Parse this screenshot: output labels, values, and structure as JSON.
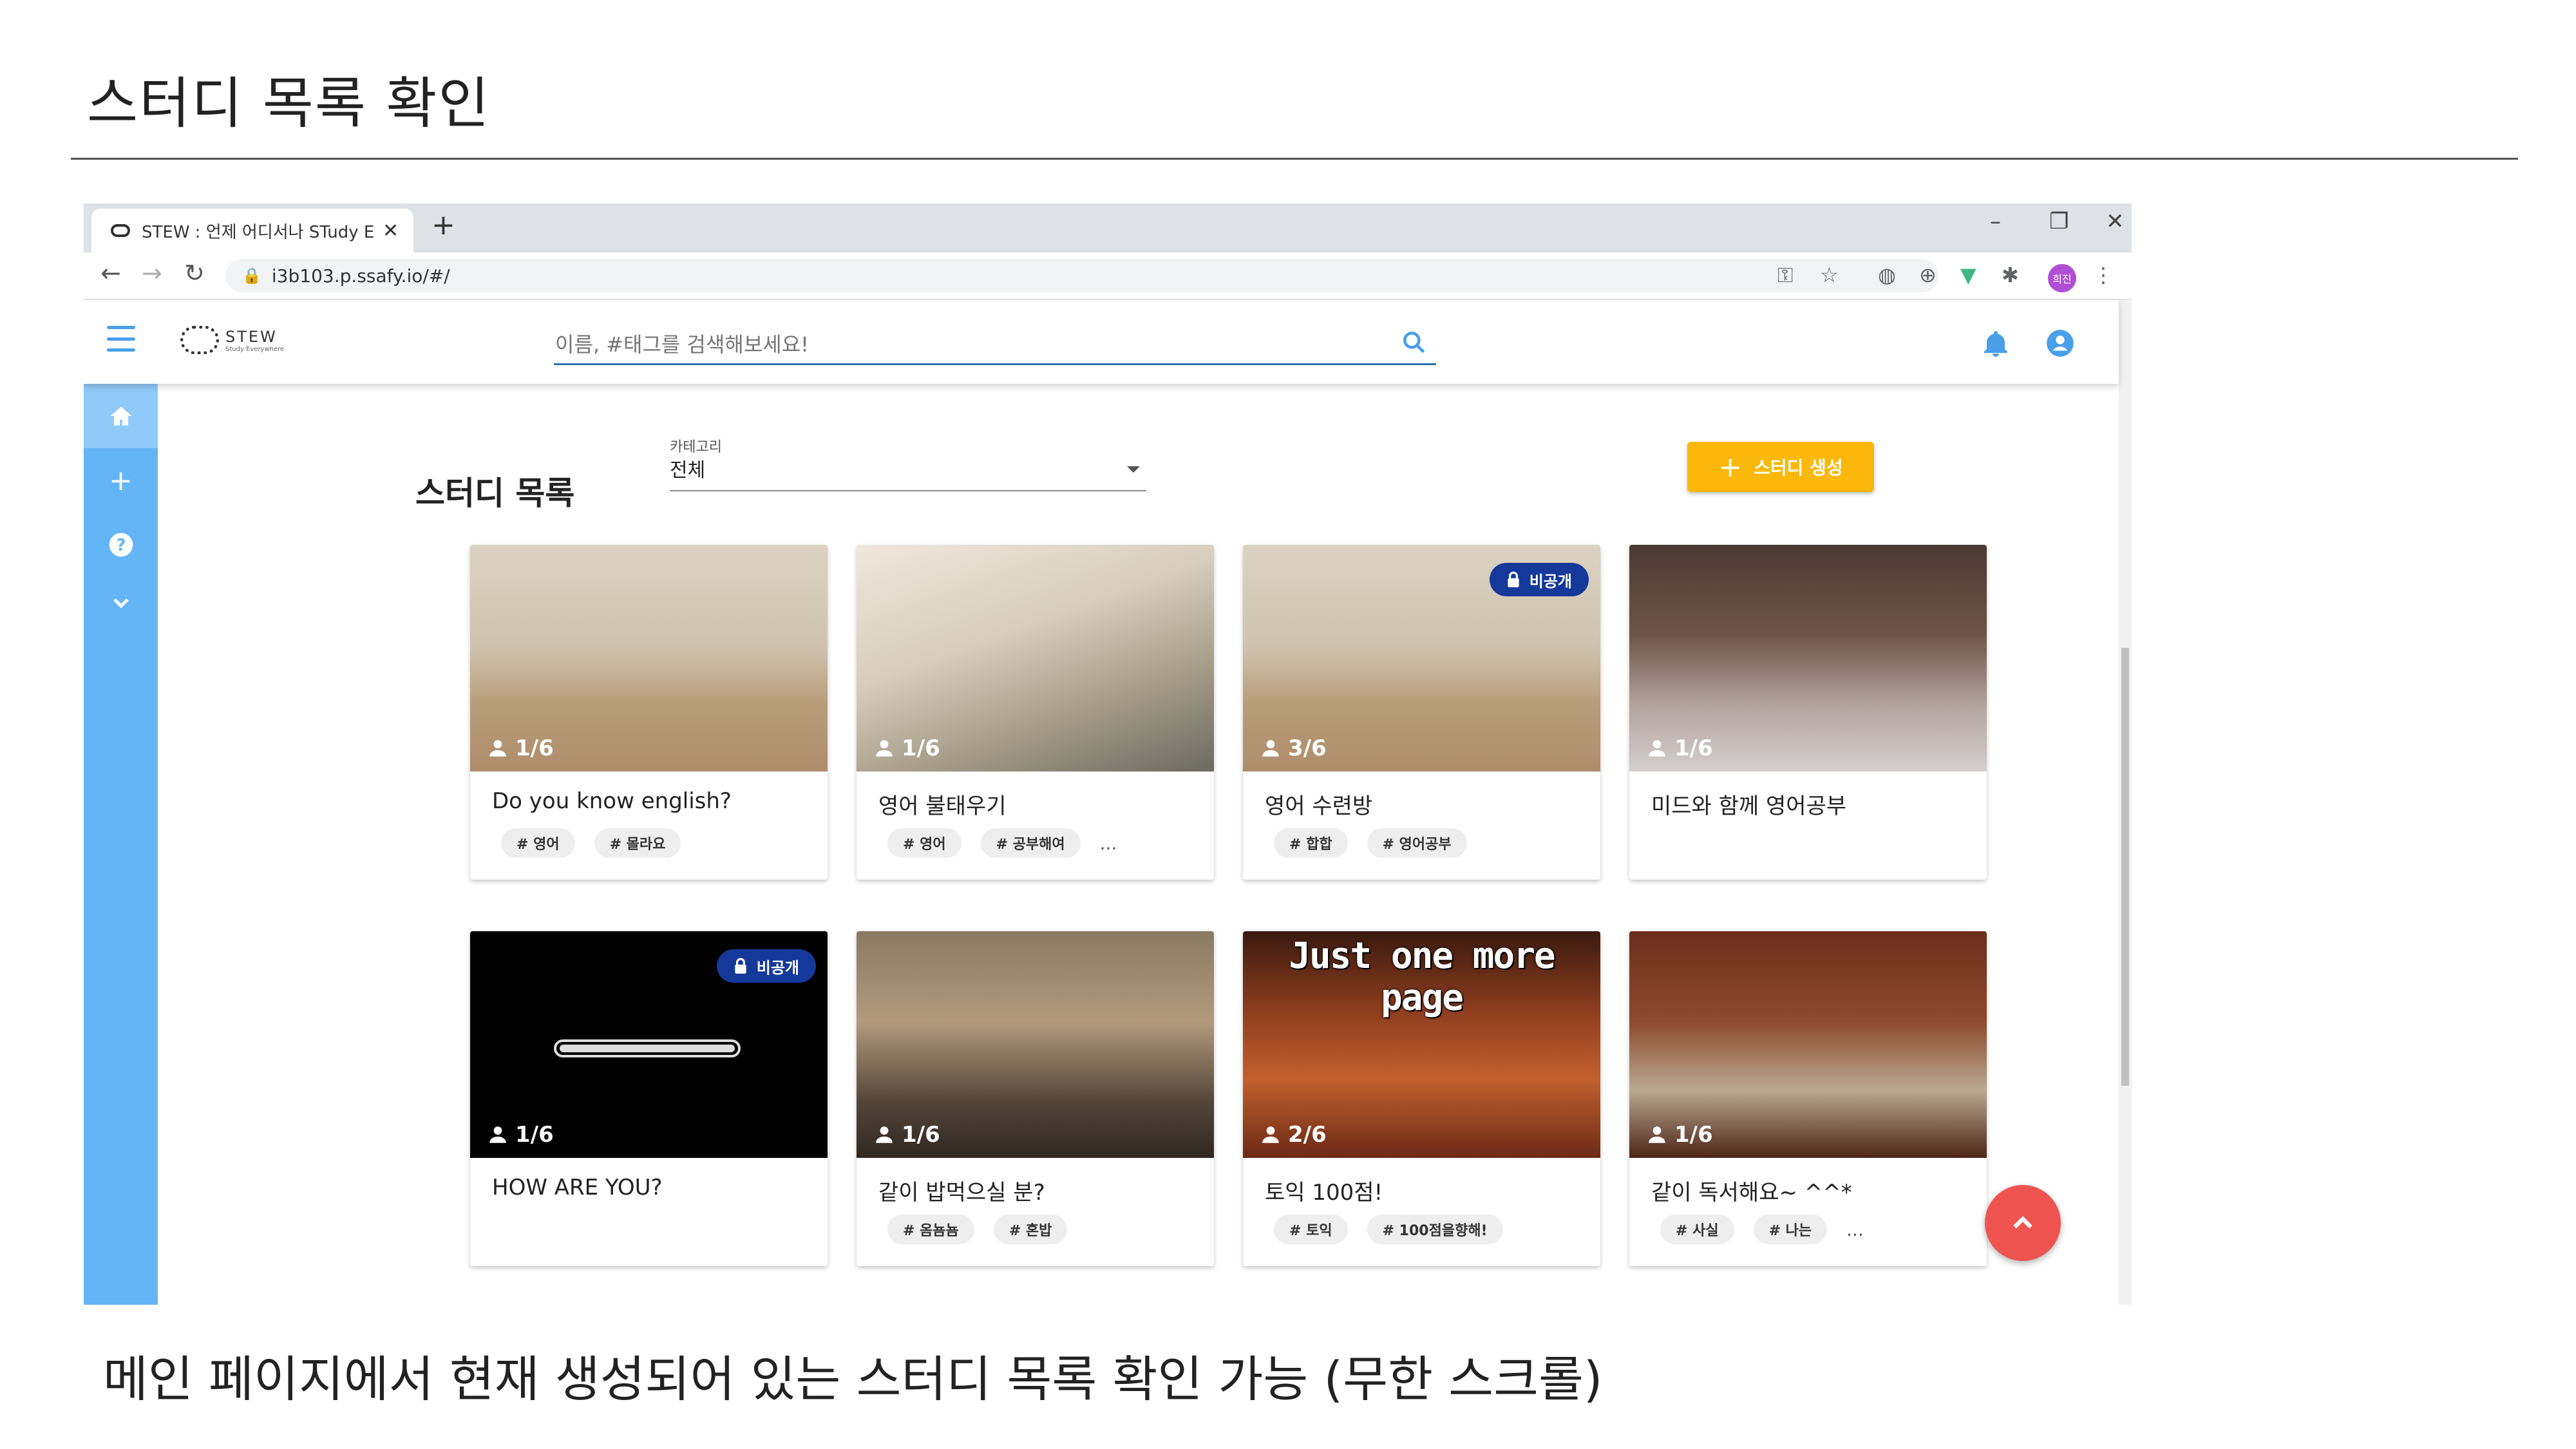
{
  "slide": {
    "title": "스터디 목록 확인",
    "caption": "메인 페이지에서 현재 생성되어 있는 스터디 목록 확인 가능 (무한 스크롤)"
  },
  "browser": {
    "tab_title": "STEW : 언제 어디서나 STudy Ev",
    "url": "i3b103.p.ssafy.io/#/",
    "profile_label": "희진"
  },
  "app": {
    "logo_name": "STEW",
    "logo_sub": "Study Everywhere",
    "search_placeholder": "이름, #태그를 검색해보세요!",
    "page_heading": "스터디 목록",
    "category_label": "카테고리",
    "category_value": "전체",
    "create_button": "스터디 생성",
    "private_label": "비공개"
  },
  "studies": [
    {
      "title": "Do you know english?",
      "count": "1/6",
      "tags": [
        "# 영어",
        "# 몰라요"
      ],
      "more": "",
      "private": false
    },
    {
      "title": "영어 불태우기",
      "count": "1/6",
      "tags": [
        "# 영어",
        "# 공부해여"
      ],
      "more": "...",
      "private": false
    },
    {
      "title": "영어 수련방",
      "count": "3/6",
      "tags": [
        "# 합합",
        "# 영어공부"
      ],
      "more": "",
      "private": true
    },
    {
      "title": "미드와 함께 영어공부",
      "count": "1/6",
      "tags": [],
      "more": "",
      "private": false
    },
    {
      "title": "HOW ARE YOU?",
      "count": "1/6",
      "tags": [],
      "more": "",
      "private": true
    },
    {
      "title": "같이 밥먹으실 분?",
      "count": "1/6",
      "tags": [
        "# 옴뇸뇸",
        "# 혼밥"
      ],
      "more": "",
      "private": false
    },
    {
      "title": "토익 100점!",
      "count": "2/6",
      "tags": [
        "# 토익",
        "# 100점을향해!"
      ],
      "more": "",
      "private": false,
      "image_text": "Just one more page"
    },
    {
      "title": "같이 독서해요~ ^^*",
      "count": "1/6",
      "tags": [
        "# 사실",
        "# 나는"
      ],
      "more": "...",
      "private": false
    }
  ],
  "icons": {
    "menu": "hamburger-icon",
    "search": "search-icon",
    "bell": "bell-icon",
    "account": "account-icon",
    "home": "home-icon",
    "add": "plus-icon",
    "help": "help-icon",
    "expand": "chevron-down-icon",
    "scroll_top": "chevron-up-icon",
    "person": "person-icon",
    "lock": "lock-icon"
  },
  "colors": {
    "primary": "#64b5f6",
    "accent_button": "#fbb80b",
    "fab": "#ef5350",
    "private_badge": "#15399a"
  }
}
